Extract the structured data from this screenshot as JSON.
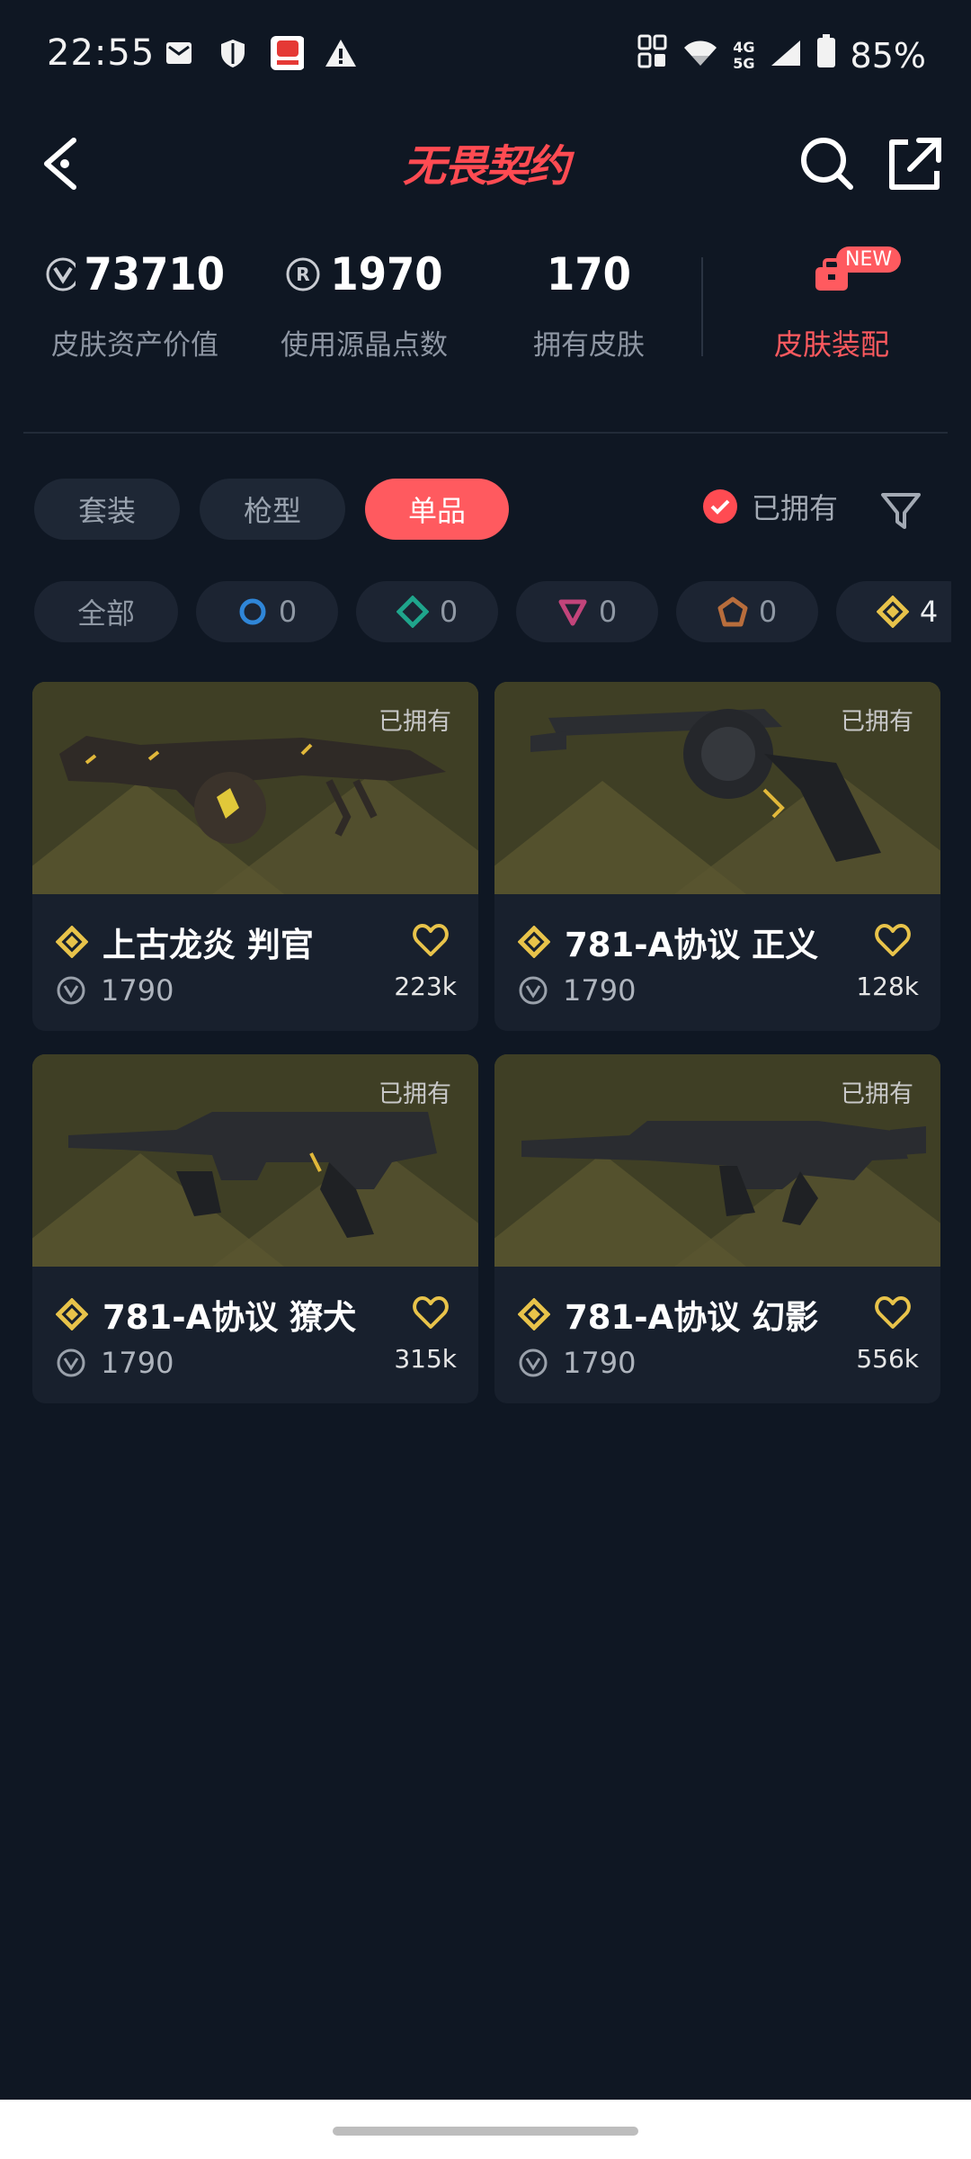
{
  "status_bar": {
    "time": "22:55",
    "battery": "85%",
    "net_top": "4G",
    "net_bottom": "5G"
  },
  "header": {
    "logo_text": "无畏契约"
  },
  "stats": {
    "asset_value": "73710",
    "asset_label": "皮肤资产价值",
    "radianite": "1970",
    "radianite_label": "使用源晶点数",
    "skins_owned": "170",
    "skins_label": "拥有皮肤",
    "outfit_label": "皮肤装配",
    "new_badge": "NEW"
  },
  "tabs": [
    "套装",
    "枪型",
    "单品"
  ],
  "owned_filter": "已拥有",
  "tiers": [
    {
      "label": "全部"
    },
    {
      "count": "0",
      "color": "#2f86d8"
    },
    {
      "count": "0",
      "color": "#1fa58c"
    },
    {
      "count": "0",
      "color": "#c2447a"
    },
    {
      "count": "0",
      "color": "#b86d3c"
    },
    {
      "count": "4",
      "color": "#e8c34a"
    }
  ],
  "cards": [
    {
      "owned": "已拥有",
      "name": "上古龙炎 判官",
      "price": "1790",
      "likes": "223k"
    },
    {
      "owned": "已拥有",
      "name": "781-A协议 正义",
      "price": "1790",
      "likes": "128k"
    },
    {
      "owned": "已拥有",
      "name": "781-A协议 獠犬",
      "price": "1790",
      "likes": "315k"
    },
    {
      "owned": "已拥有",
      "name": "781-A协议 幻影",
      "price": "1790",
      "likes": "556k"
    }
  ]
}
